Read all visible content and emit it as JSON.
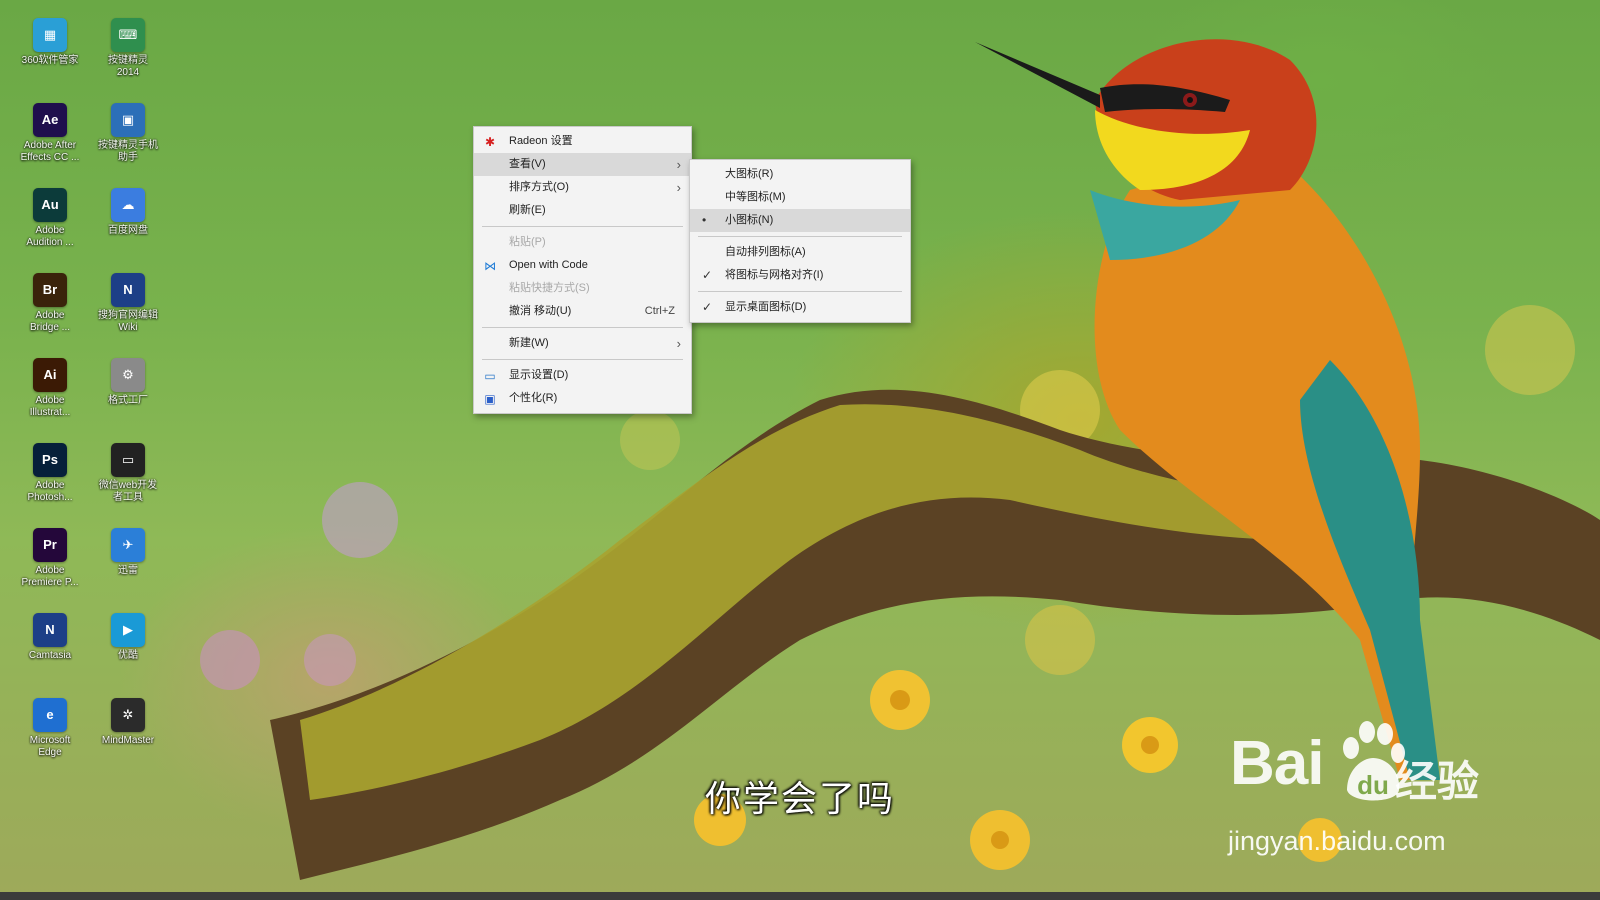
{
  "desktop_icons": [
    {
      "label": "360软件管家",
      "color": "#2a9fd6",
      "glyph": "▦"
    },
    {
      "label": "按键精灵\n2014",
      "color": "#2f8f4e",
      "glyph": "⌨"
    },
    {
      "label": "Adobe After\nEffects CC ...",
      "color": "#1f0f4d",
      "glyph": "Ae"
    },
    {
      "label": "按键精灵手机\n助手",
      "color": "#2c6fb8",
      "glyph": "▣"
    },
    {
      "label": "Adobe\nAudition ...",
      "color": "#0c3b3a",
      "glyph": "Au"
    },
    {
      "label": "百度网盘",
      "color": "#3b7de0",
      "glyph": "☁"
    },
    {
      "label": "Adobe\nBridge ...",
      "color": "#3a230b",
      "glyph": "Br"
    },
    {
      "label": "搜狗官网编辑\nWiki",
      "color": "#1d3f87",
      "glyph": "N"
    },
    {
      "label": "Adobe\nIllustrat...",
      "color": "#3b1a05",
      "glyph": "Ai"
    },
    {
      "label": "格式工厂",
      "color": "#8a8a8a",
      "glyph": "⚙"
    },
    {
      "label": "Adobe\nPhotosh...",
      "color": "#06203a",
      "glyph": "Ps"
    },
    {
      "label": "微信web开发\n者工具",
      "color": "#222222",
      "glyph": "▭"
    },
    {
      "label": "Adobe\nPremiere P...",
      "color": "#24073a",
      "glyph": "Pr"
    },
    {
      "label": "迅雷",
      "color": "#2b7fd8",
      "glyph": "✈"
    },
    {
      "label": "Camtasia",
      "color": "#1d3f87",
      "glyph": "N"
    },
    {
      "label": "优酷",
      "color": "#1a9ad6",
      "glyph": "▶"
    },
    {
      "label": "Microsoft\nEdge",
      "color": "#1f6fd1",
      "glyph": "e"
    },
    {
      "label": "MindMaster",
      "color": "#2b2b2b",
      "glyph": "✲"
    }
  ],
  "context_menu": {
    "items": [
      {
        "kind": "item",
        "label": "Radeon 设置",
        "icon": "radeon-icon",
        "icon_glyph": "✱",
        "icon_color": "#d62020"
      },
      {
        "kind": "item",
        "label": "查看(V)",
        "submenu": true,
        "highlighted": true
      },
      {
        "kind": "item",
        "label": "排序方式(O)",
        "submenu": true
      },
      {
        "kind": "item",
        "label": "刷新(E)"
      },
      {
        "kind": "sep"
      },
      {
        "kind": "item",
        "label": "粘贴(P)",
        "disabled": true
      },
      {
        "kind": "item",
        "label": "Open with Code",
        "icon": "vscode-icon",
        "icon_glyph": "⋈",
        "icon_color": "#1e7bd6"
      },
      {
        "kind": "item",
        "label": "粘贴快捷方式(S)",
        "disabled": true
      },
      {
        "kind": "item",
        "label": "撤消 移动(U)",
        "shortcut": "Ctrl+Z"
      },
      {
        "kind": "sep"
      },
      {
        "kind": "item",
        "label": "新建(W)",
        "submenu": true
      },
      {
        "kind": "sep"
      },
      {
        "kind": "item",
        "label": "显示设置(D)",
        "icon": "display-settings-icon",
        "icon_glyph": "▭",
        "icon_color": "#2b78c9"
      },
      {
        "kind": "item",
        "label": "个性化(R)",
        "icon": "personalize-icon",
        "icon_glyph": "▣",
        "icon_color": "#2b5fc9"
      }
    ]
  },
  "view_submenu": {
    "items": [
      {
        "kind": "item",
        "label": "大图标(R)"
      },
      {
        "kind": "item",
        "label": "中等图标(M)"
      },
      {
        "kind": "item",
        "label": "小图标(N)",
        "mark": "•",
        "highlighted": true
      },
      {
        "kind": "sep"
      },
      {
        "kind": "item",
        "label": "自动排列图标(A)"
      },
      {
        "kind": "item",
        "label": "将图标与网格对齐(I)",
        "mark": "✓"
      },
      {
        "kind": "sep"
      },
      {
        "kind": "item",
        "label": "显示桌面图标(D)",
        "mark": "✓"
      }
    ]
  },
  "caption": "你学会了吗",
  "watermark": {
    "brand": "Bai",
    "brand_tail": "经验",
    "url": "jingyan.baidu.com"
  }
}
